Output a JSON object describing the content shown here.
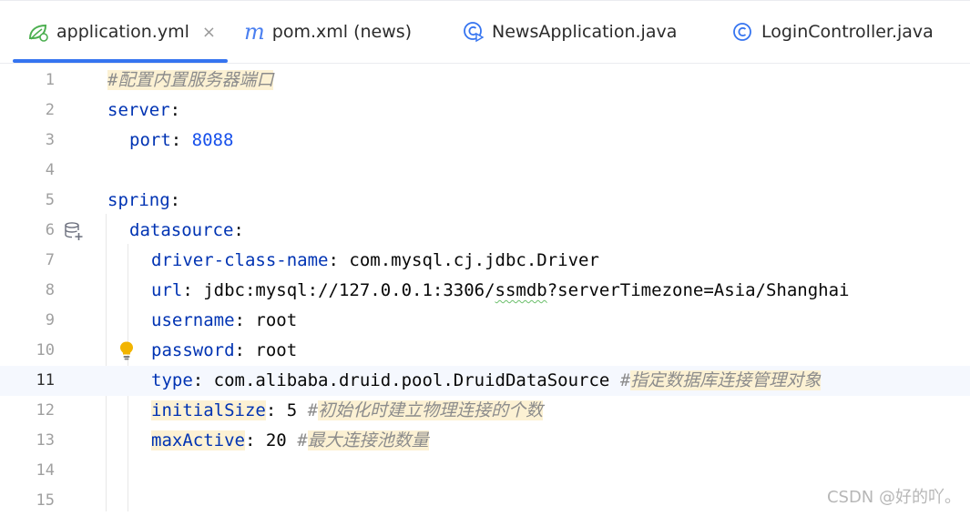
{
  "tabs": [
    {
      "label": "application.yml",
      "icon": "spring-leaf-icon",
      "active": true,
      "close": "×"
    },
    {
      "label": "pom.xml (news)",
      "icon": "maven-m-icon",
      "icon_glyph": "m"
    },
    {
      "label": "NewsApplication.java",
      "icon": "java-class-run-icon"
    },
    {
      "label": "LoginController.java",
      "icon": "java-class-icon"
    }
  ],
  "editor": {
    "current_line": 11,
    "lines": [
      {
        "num": "1"
      },
      {
        "num": "2"
      },
      {
        "num": "3"
      },
      {
        "num": "4"
      },
      {
        "num": "5"
      },
      {
        "num": "6"
      },
      {
        "num": "7"
      },
      {
        "num": "8"
      },
      {
        "num": "9"
      },
      {
        "num": "10"
      },
      {
        "num": "11"
      },
      {
        "num": "12"
      },
      {
        "num": "13"
      },
      {
        "num": "14"
      },
      {
        "num": "15"
      }
    ],
    "code": {
      "l1_comment": "#配置内置服务器端口",
      "l2_key": "server",
      "l3_key": "port",
      "l3_val": "8088",
      "l5_key": "spring",
      "l6_key": "datasource",
      "l7_key": "driver-class-name",
      "l7_val": "com.mysql.cj.jdbc.Driver",
      "l8_key": "url",
      "l8_val_a": "jdbc:mysql://127.0.0.1:3306/",
      "l8_val_b": "ssmdb",
      "l8_val_c": "?serverTimezone=Asia/Shanghai",
      "l9_key": "username",
      "l9_val": "root",
      "l10_key": "password",
      "l10_val": "root",
      "l11_key": "type",
      "l11_val": "com.alibaba.druid.pool.DruidDataSource",
      "l11_hash": "#",
      "l11_comment": "指定数据库连接管理对象",
      "l12_key": "initialSize",
      "l12_val": "5",
      "l12_hash": "#",
      "l12_comment": "初始化时建立物理连接的个数",
      "l13_key": "maxActive",
      "l13_val": "20",
      "l13_hash": "#",
      "l13_comment": "最大连接池数量",
      "colon": ":"
    },
    "gutter_icons": {
      "line6": "database-add-icon",
      "line10": "lightbulb-intention-icon"
    }
  },
  "watermark": "CSDN @好的吖。",
  "colors": {
    "accent": "#3574f0",
    "key": "#0033b3",
    "number": "#1750eb",
    "comment": "#8c8c8c",
    "highlight": "#fcf1d3",
    "current_line": "#f5f8fe"
  }
}
